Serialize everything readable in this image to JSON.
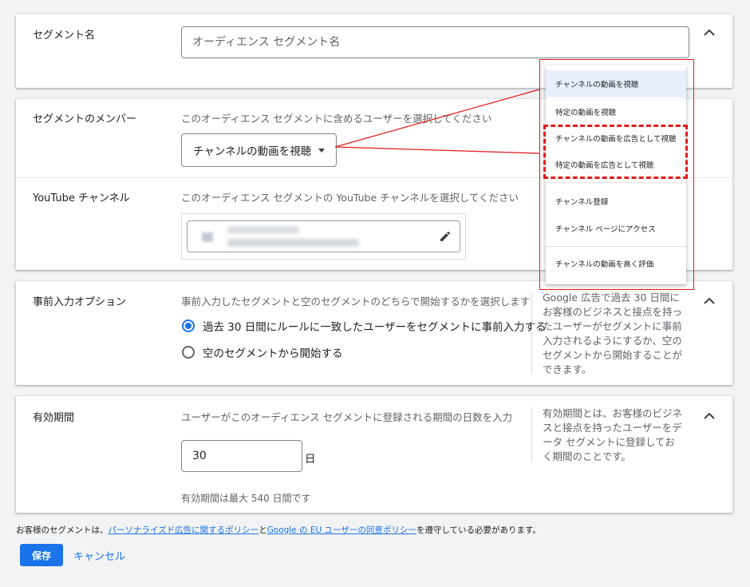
{
  "segment_name": {
    "label": "セグメント名",
    "placeholder": "オーディエンス セグメント名"
  },
  "members": {
    "label": "セグメントのメンバー",
    "description": "このオーディエンス セグメントに含めるユーザーを選択してください",
    "selected": "チャンネルの動画を視聴"
  },
  "youtube_channel": {
    "label": "YouTube チャンネル",
    "description": "このオーディエンス セグメントの YouTube チャンネルを選択してください"
  },
  "prefill": {
    "label": "事前入力オプション",
    "description": "事前入力したセグメントと空のセグメントのどちらで開始するかを選択します",
    "option1": "過去 30 日間にルールに一致したユーザーをセグメントに事前入力する",
    "option2": "空のセグメントから開始する",
    "help": "Google 広告で過去 30 日間にお客様のビジネスと接点を持ったユーザーがセグメントに事前入力されるようにするか、空のセグメントから開始することができます。"
  },
  "duration": {
    "label": "有効期間",
    "description": "ユーザーがこのオーディエンス セグメントに登録される期間の日数を入力",
    "value": "30",
    "unit": "日",
    "hint": "有効期間は最大 540 日間です",
    "help": "有効期間とは、お客様のビジネスと接点を持ったユーザーをデータ セグメントに登録しておく期間のことです。"
  },
  "policy": {
    "prefix": "お客様のセグメントは、",
    "link1": "パーソナライズド広告に関するポリシー",
    "middle": "と",
    "link2": "Google の EU ユーザーの同意ポリシー",
    "suffix": "を遵守している必要があります。"
  },
  "actions": {
    "save": "保存",
    "cancel": "キャンセル"
  },
  "dropdown_menu": {
    "items": [
      "チャンネルの動画を視聴",
      "特定の動画を視聴",
      "チャンネルの動画を広告として視聴",
      "特定の動画を広告として視聴",
      "チャンネル登録",
      "チャンネル ページにアクセス",
      "チャンネルの動画を高く評価"
    ]
  },
  "colors": {
    "accent": "#1a73e8",
    "annotation": "#e21b1b"
  },
  "icons": {
    "collapse": "chevron-up-icon",
    "edit": "pencil-icon",
    "dropdown": "caret-down-icon"
  }
}
